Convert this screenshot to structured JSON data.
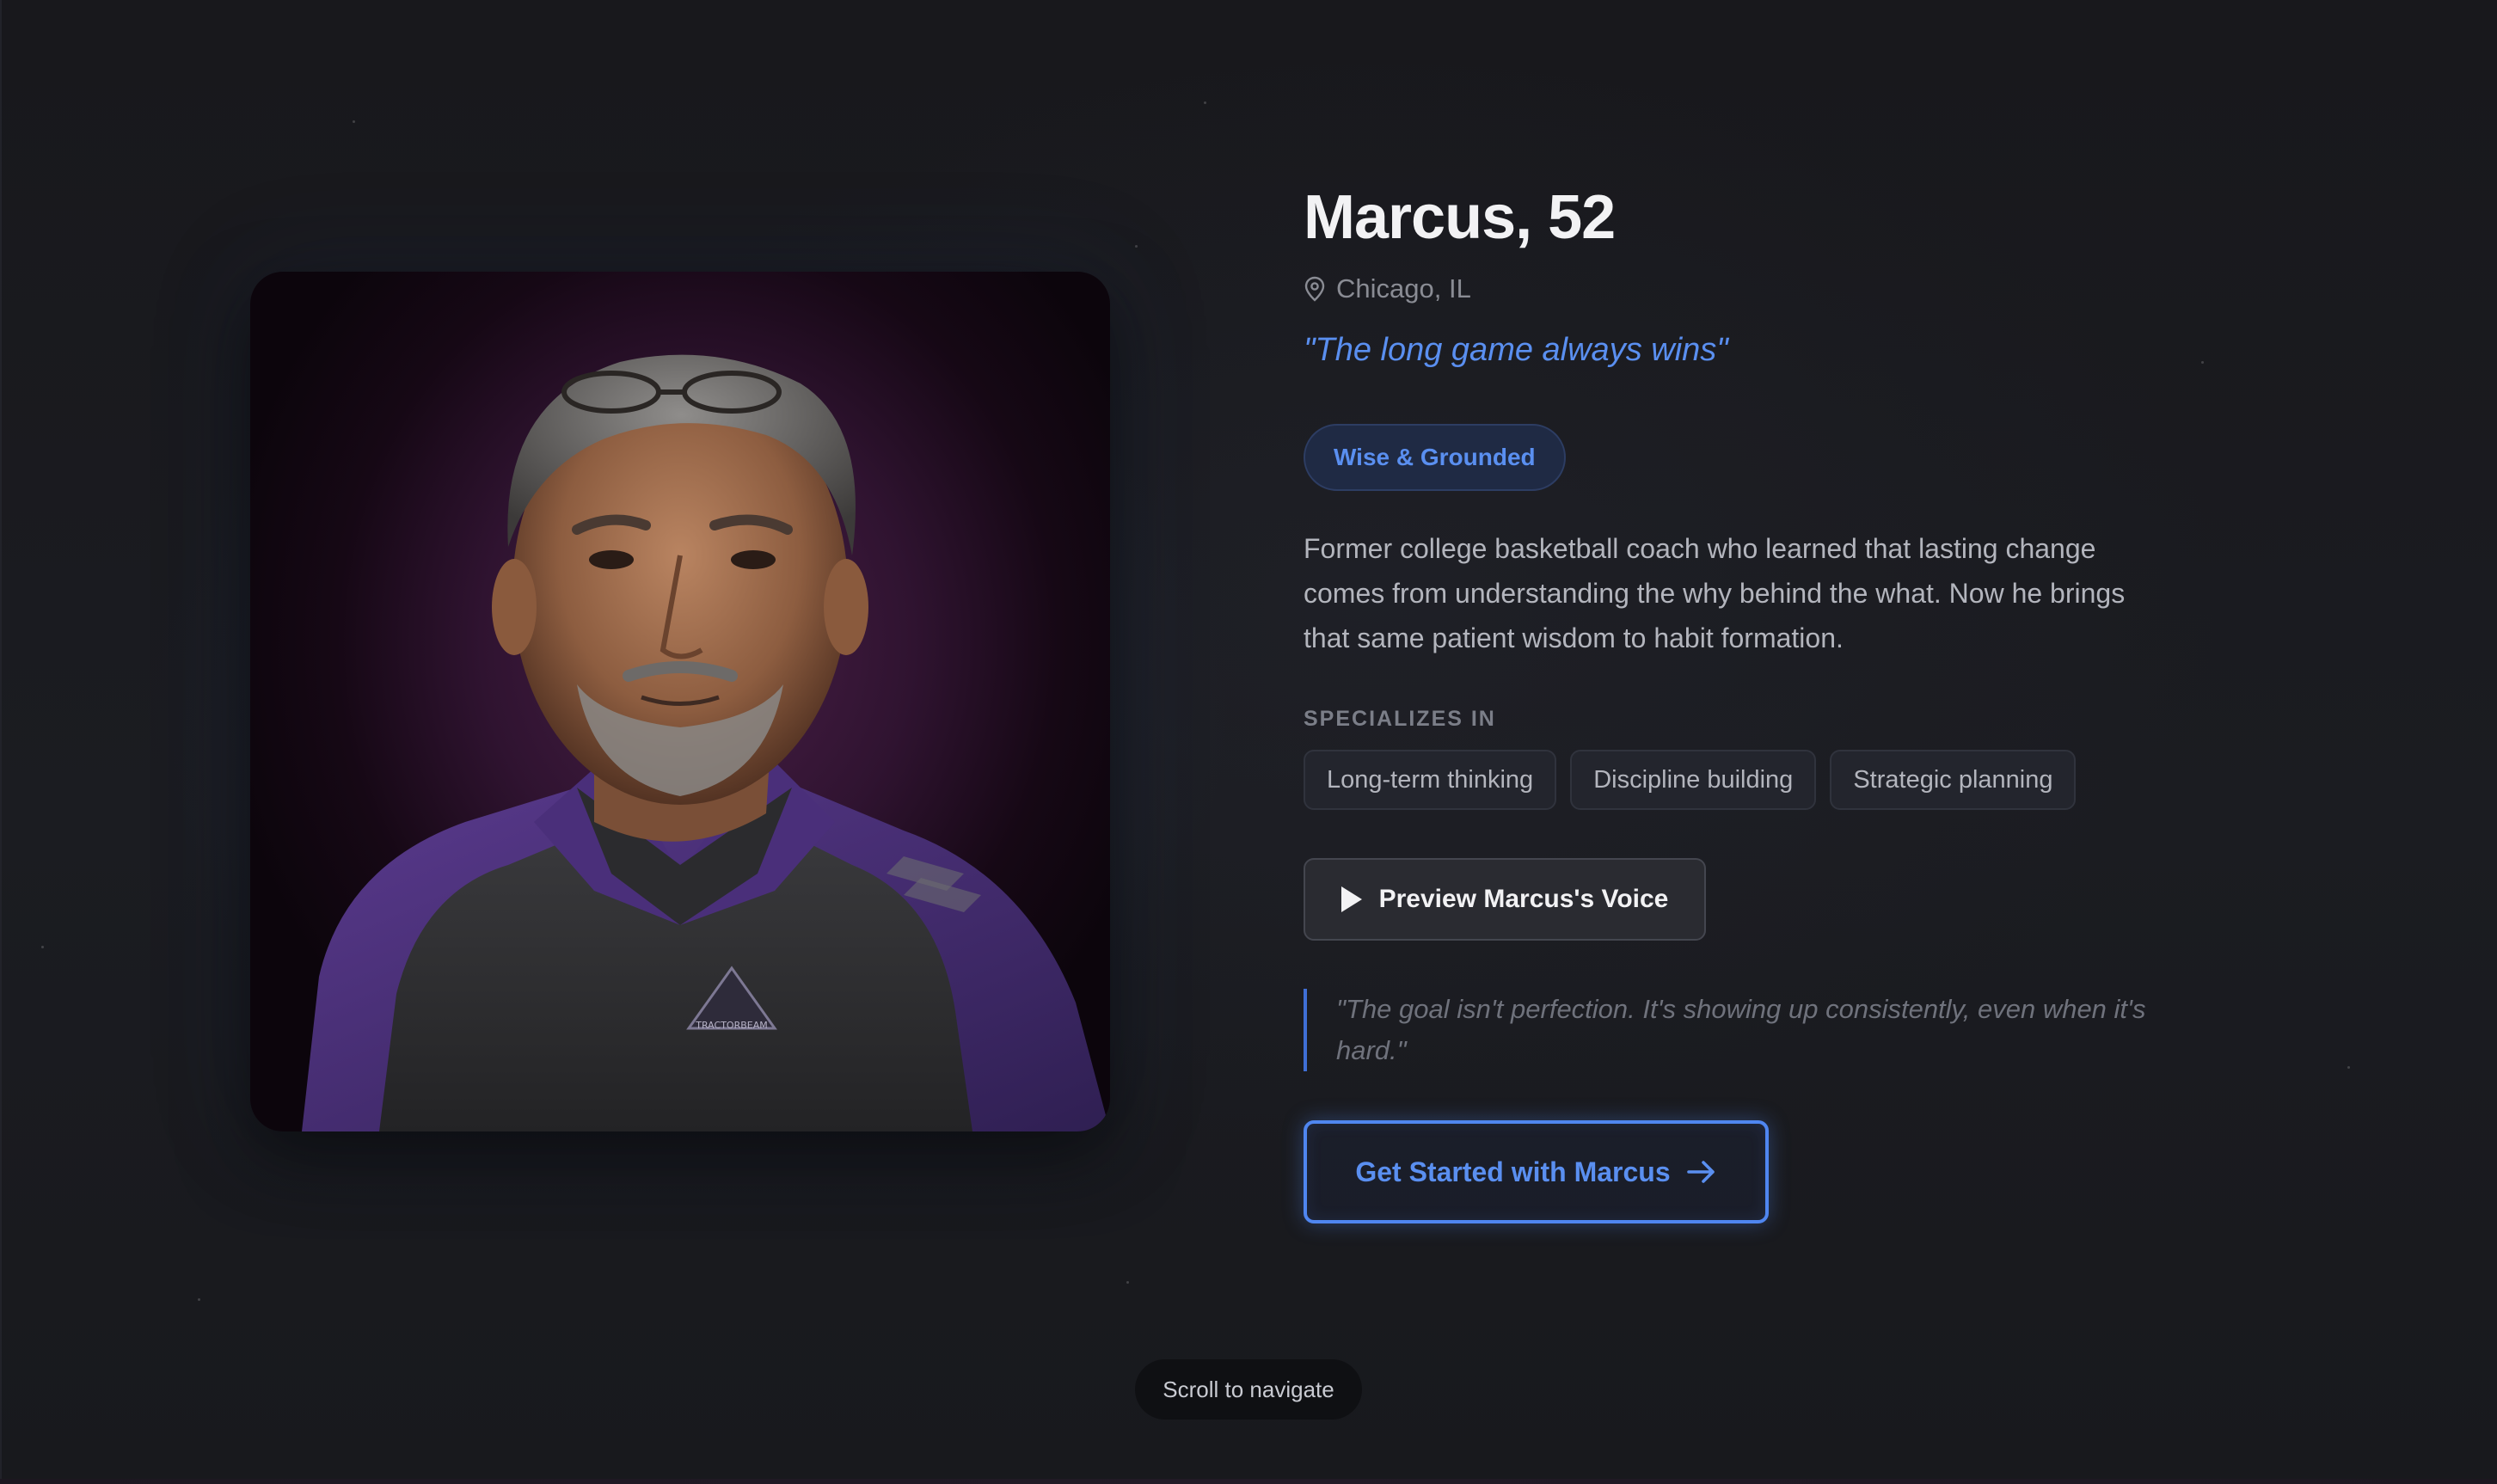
{
  "profile": {
    "name": "Marcus, 52",
    "location": "Chicago, IL",
    "tagline": "\"The long game always wins\"",
    "personality_badge": "Wise & Grounded",
    "bio": "Former college basketball coach who learned that lasting change comes from understanding the why behind the what. Now he brings that same patient wisdom to habit formation.",
    "specializes_label": "SPECIALIZES IN",
    "specialties": [
      "Long-term thinking",
      "Discipline building",
      "Strategic planning"
    ],
    "voice_button": "Preview Marcus's Voice",
    "quote": "\"The goal isn't perfection. It's showing up consistently, even when it's hard.\"",
    "cta": "Get Started with Marcus",
    "portrait_badge_text": "TRACTORBEAM"
  },
  "footer": {
    "scroll_hint": "Scroll to navigate"
  },
  "icons": {
    "location": "map-pin-icon",
    "play": "play-icon",
    "arrow": "arrow-right-icon"
  },
  "colors": {
    "background": "#18191d",
    "accent_blue": "#5a8ff0",
    "badge_bg": "#1f2a44",
    "portrait_bg": "#3a1838",
    "uniform_purple": "#4a2f7a"
  }
}
